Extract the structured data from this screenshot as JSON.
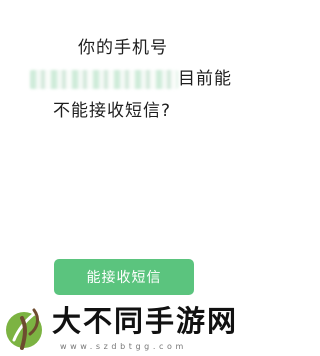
{
  "question": {
    "line1": "你的手机号",
    "line2_suffix": "目前能",
    "line3": "不能接收短信?"
  },
  "actions": {
    "confirm_label": "能接收短信"
  },
  "watermark": {
    "title": "大不同手游网",
    "url": "www.szdbtgg.com"
  },
  "colors": {
    "button": "#5bc47e",
    "text": "#1e1e1e",
    "logo_green": "#7cb342",
    "logo_brown": "#6d4c2f"
  }
}
